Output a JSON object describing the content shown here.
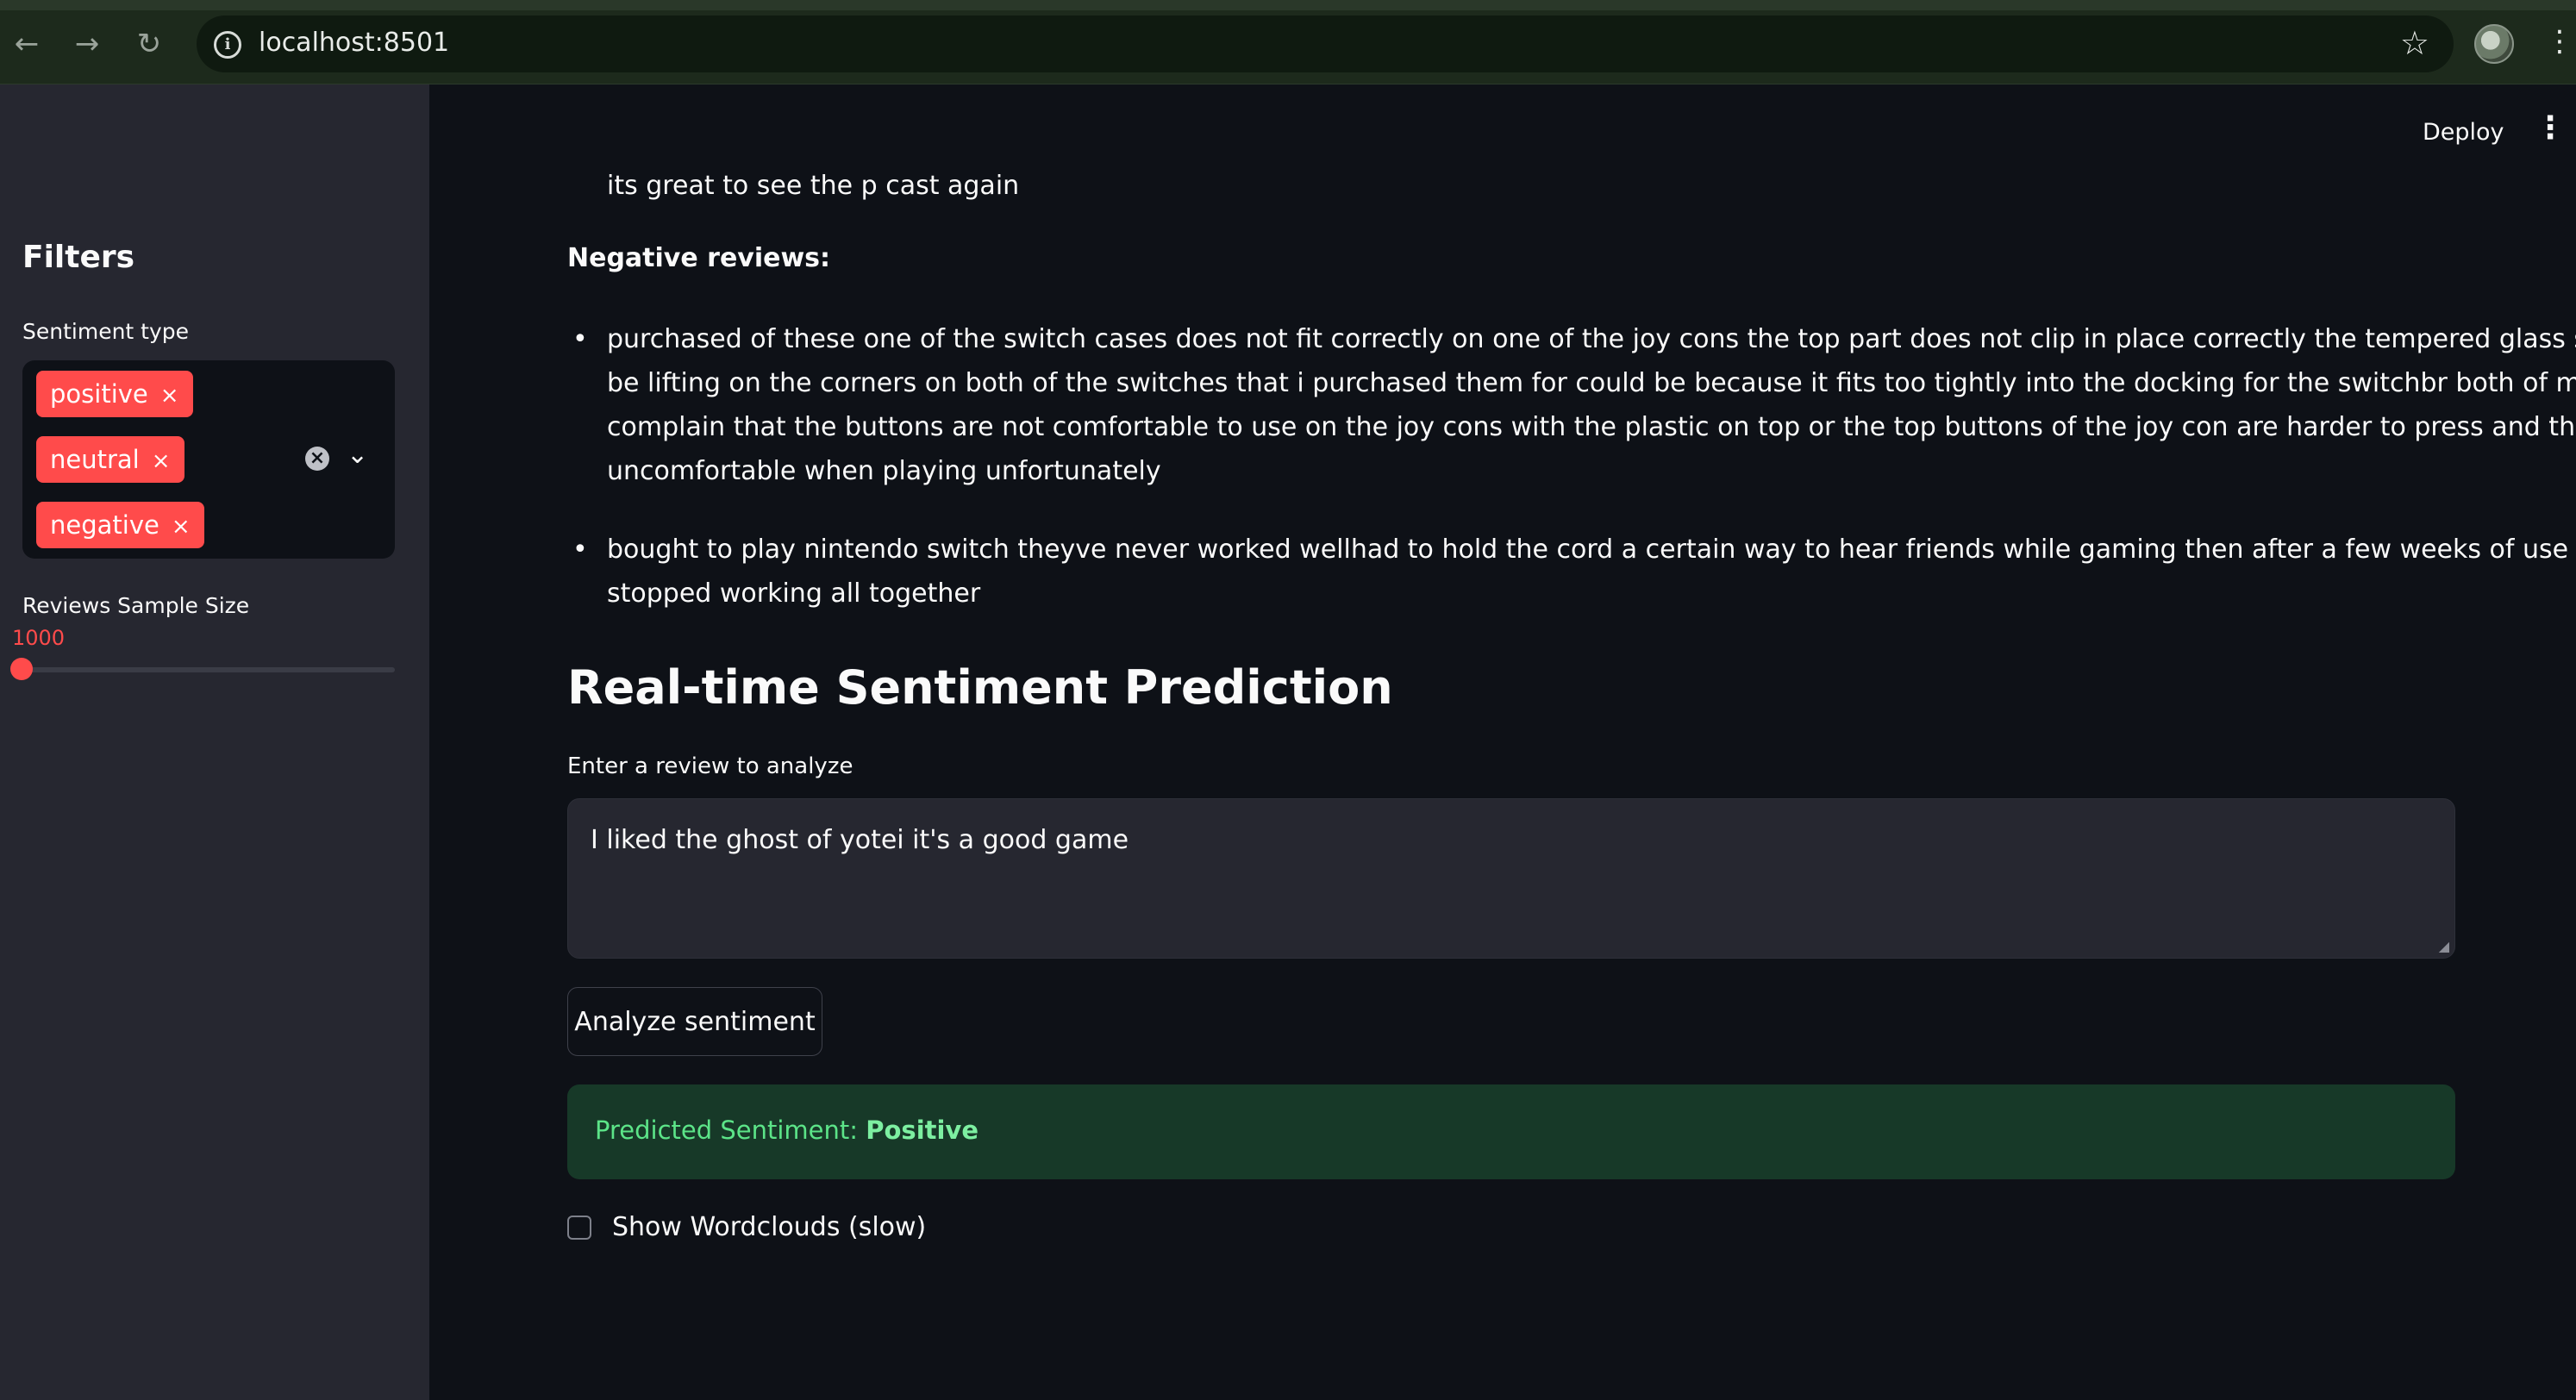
{
  "browser": {
    "url": "localhost:8501",
    "back_icon": "←",
    "forward_icon": "→",
    "reload_icon": "↻",
    "info_icon": "i",
    "star_icon": "☆",
    "menu_icon": "⋮"
  },
  "sidebar": {
    "title": "Filters",
    "sentiment_label": "Sentiment type",
    "tags": [
      "positive",
      "neutral",
      "negative"
    ],
    "tag_remove": "×",
    "clear_icon": "×",
    "chevron_icon": "⌄",
    "slider_label": "Reviews Sample Size",
    "slider_value": "1000",
    "slider_fraction": 0.0
  },
  "header": {
    "deploy_label": "Deploy",
    "menu_icon": "⋮"
  },
  "main": {
    "clipped_line": "its great to see the p cast again",
    "negative_heading": "Negative reviews:",
    "negative_reviews": [
      [
        "purchased of these one of the switch cases does not fit correctly on one of the joy cons  the top part does not clip in place correctly  the tempered glass seems to",
        "be lifting on the corners on both of the switches that i purchased them for could be because it fits too tightly into the docking for the switchbr   both of my kids",
        "complain that the buttons are not comfortable to use on the joy cons with the plastic on top or the top buttons of the joy con are harder to press and therefore",
        "uncomfortable when playing unfortunately"
      ],
      [
        "bought to play nintendo switch theyve never worked wellhad to hold the cord a certain way to hear friends while gaming then after a few weeks of use they",
        "stopped working all together"
      ]
    ],
    "bullet_glyph": "•",
    "section_heading": "Real-time Sentiment Prediction",
    "input_label": "Enter a review to analyze",
    "input_value": "I liked the ghost of yotei it's a good game",
    "analyze_button": "Analyze sentiment",
    "result_prefix": "Predicted Sentiment: ",
    "result_value": "Positive",
    "checkbox_label": "Show Wordclouds (slow)"
  },
  "colors": {
    "accent": "#ff4b4b",
    "background": "#0e1117",
    "sidebar": "#262730",
    "success_bg": "#173928",
    "success_text": "#5ce488"
  }
}
